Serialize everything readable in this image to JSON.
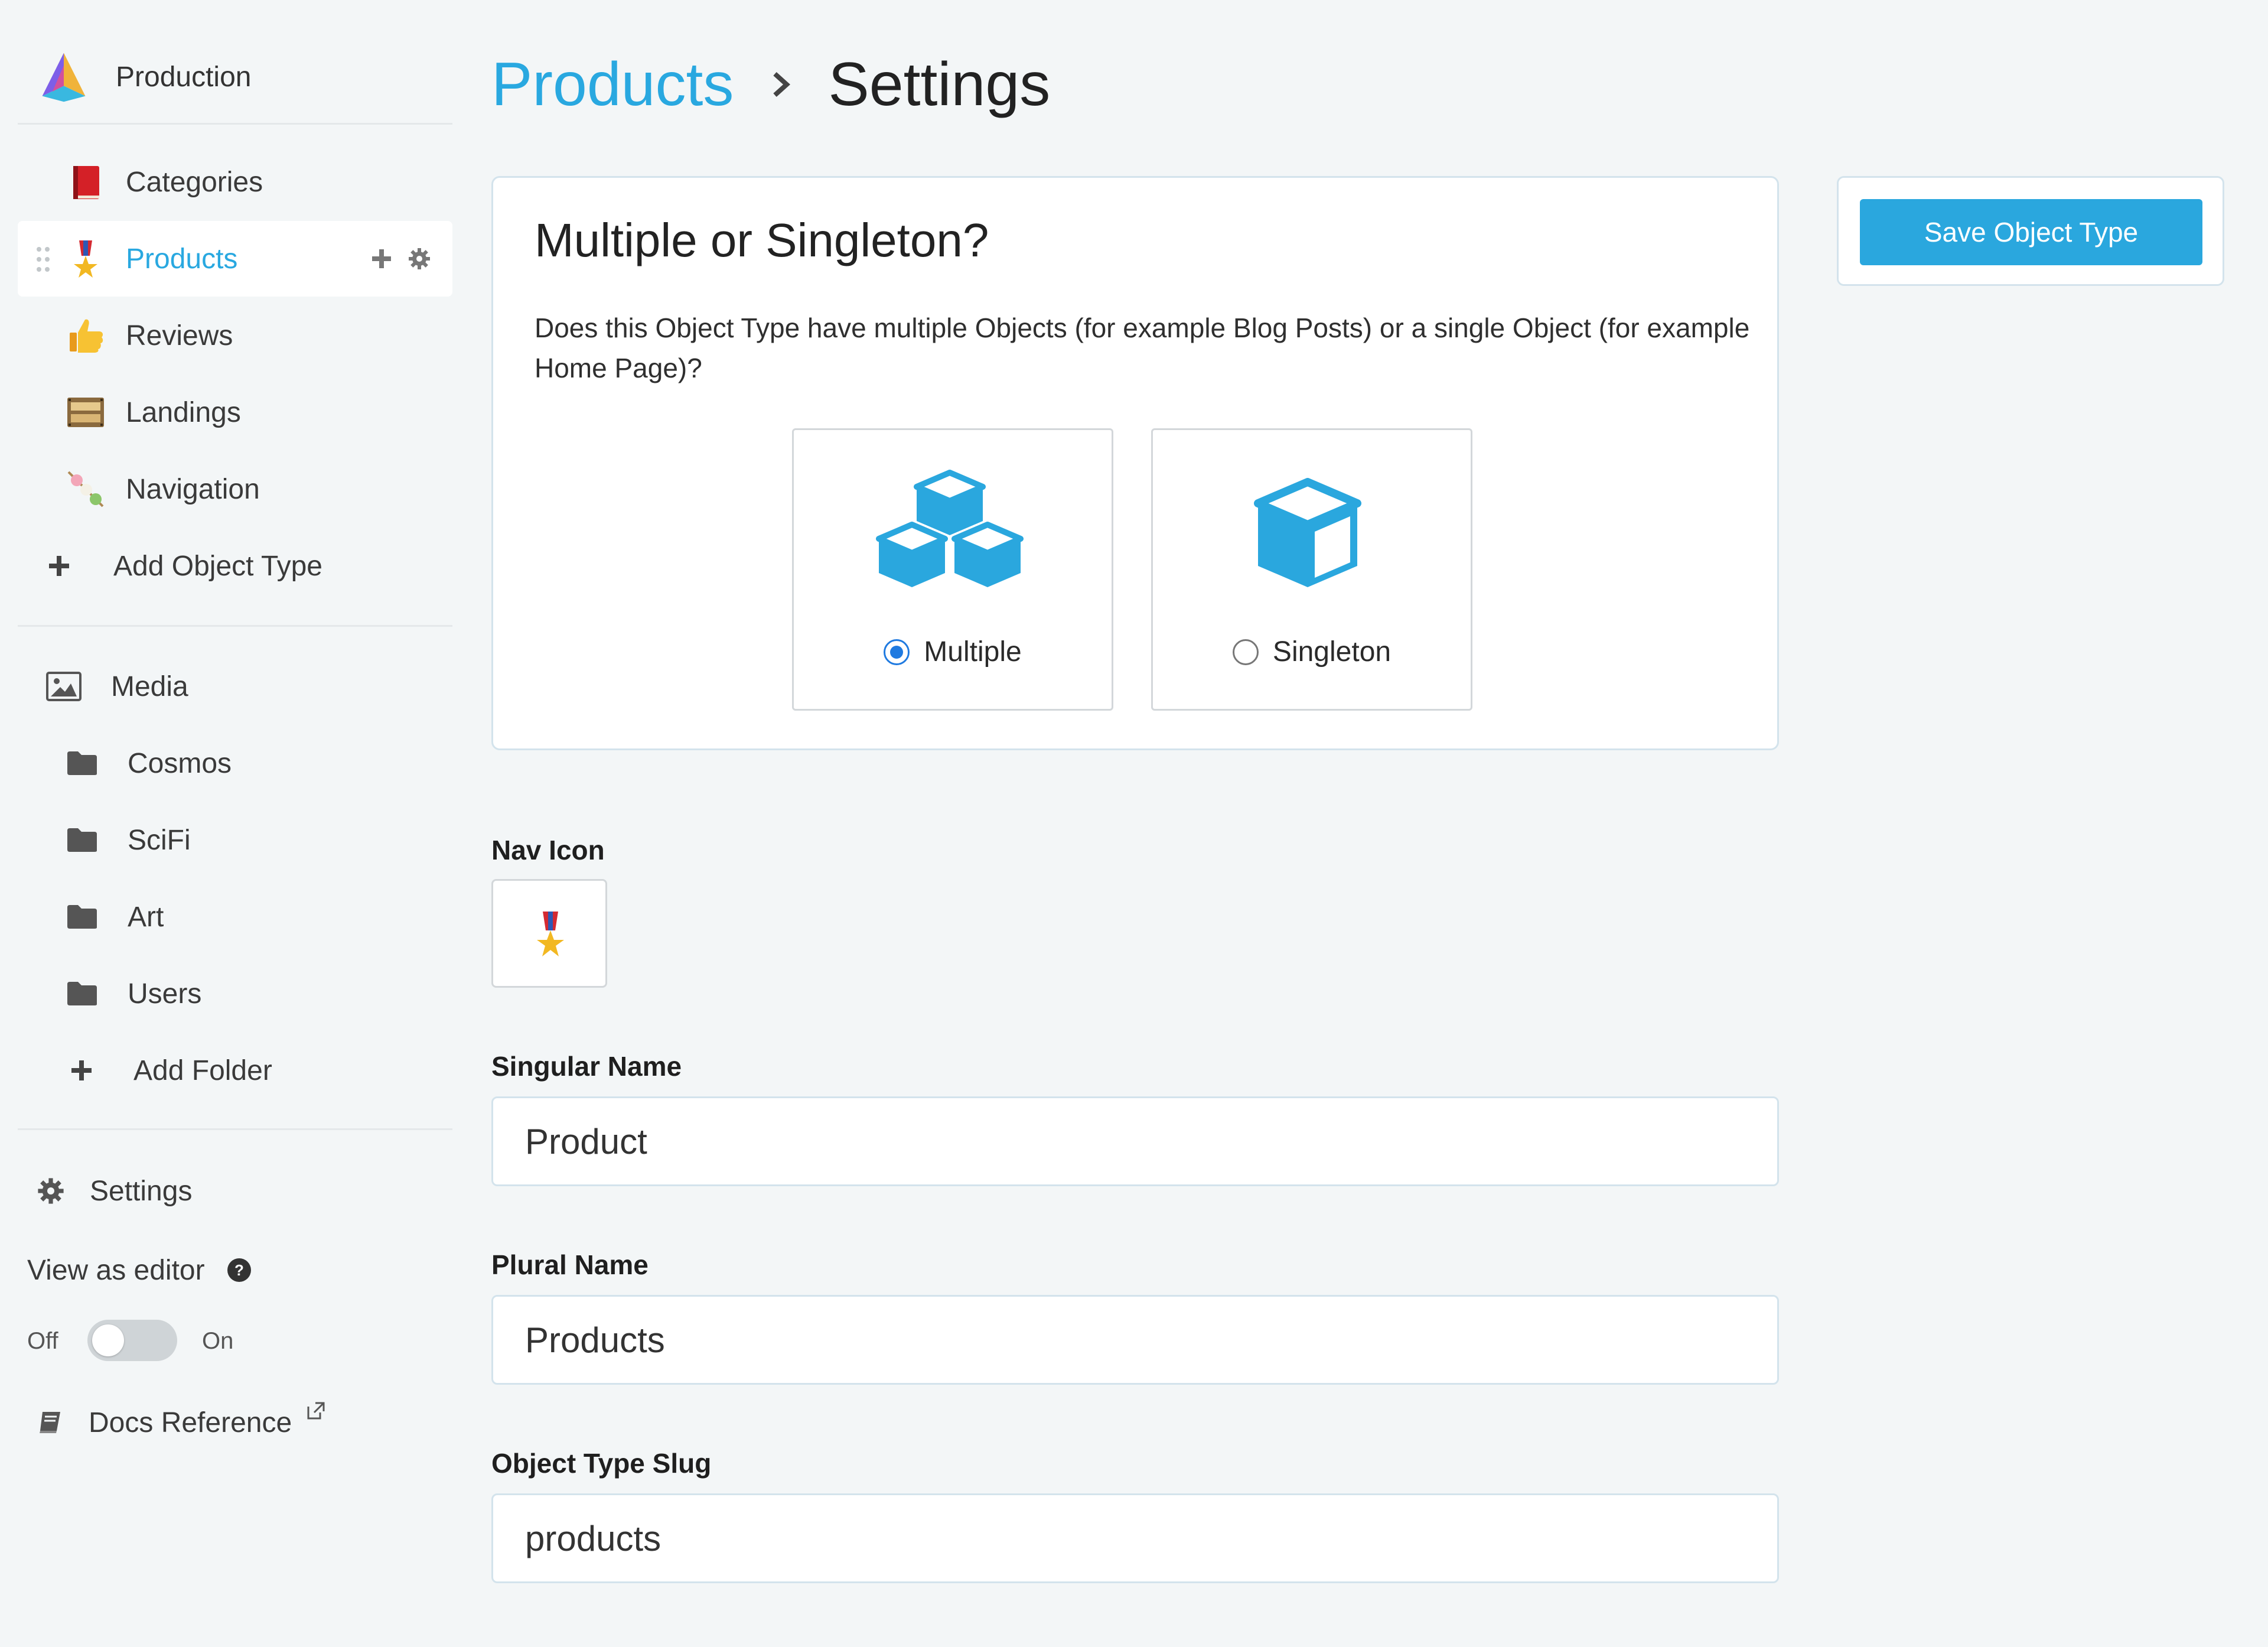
{
  "sidebar": {
    "workspace_name": "Production",
    "object_types": [
      {
        "label": "Categories",
        "icon": "red-book-icon"
      },
      {
        "label": "Products",
        "icon": "military-medal-icon",
        "active": true
      },
      {
        "label": "Reviews",
        "icon": "thumbs-up-icon"
      },
      {
        "label": "Landings",
        "icon": "film-frames-icon"
      },
      {
        "label": "Navigation",
        "icon": "dango-icon"
      }
    ],
    "add_object_type": "Add Object Type",
    "media_label": "Media",
    "folders": [
      {
        "label": "Cosmos"
      },
      {
        "label": "SciFi"
      },
      {
        "label": "Art"
      },
      {
        "label": "Users"
      }
    ],
    "add_folder": "Add Folder",
    "settings_label": "Settings",
    "view_as_editor": "View as editor",
    "toggle_off": "Off",
    "toggle_on": "On",
    "toggle_state": "off",
    "docs_reference": "Docs Reference"
  },
  "breadcrumb": {
    "parent": "Products",
    "current": "Settings"
  },
  "card": {
    "title": "Multiple or Singleton?",
    "description": "Does this Object Type have multiple Objects (for example Blog Posts) or a single Object (for example Home Page)?",
    "options": [
      {
        "label": "Multiple",
        "selected": true
      },
      {
        "label": "Singleton",
        "selected": false
      }
    ]
  },
  "form": {
    "nav_icon_label": "Nav Icon",
    "singular_label": "Singular Name",
    "singular_value": "Product",
    "plural_label": "Plural Name",
    "plural_value": "Products",
    "slug_label": "Object Type Slug",
    "slug_value": "products"
  },
  "actions": {
    "save_label": "Save Object Type"
  },
  "colors": {
    "accent": "#29a8e0",
    "button": "#2aa7de",
    "radio_selected": "#1f7ae0",
    "background": "#f3f6f7"
  }
}
